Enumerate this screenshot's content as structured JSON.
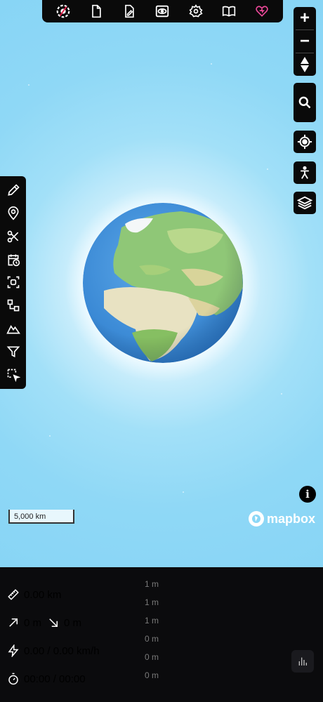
{
  "top_toolbar": {
    "items": [
      {
        "icon": "gpx-logo-icon"
      },
      {
        "icon": "new-file-icon"
      },
      {
        "icon": "edit-file-icon"
      },
      {
        "icon": "view-icon"
      },
      {
        "icon": "settings-gear-icon"
      },
      {
        "icon": "help-book-icon"
      },
      {
        "icon": "donate-heart-icon",
        "color": "#ec4899"
      }
    ]
  },
  "map_controls": {
    "zoom_in": "+",
    "zoom_out": "−",
    "compass": "compass-icon",
    "search": "search-icon",
    "locate": "locate-icon",
    "street_view": "pedestrian-icon",
    "layers": "layers-icon"
  },
  "left_tools": [
    {
      "icon": "pencil-icon"
    },
    {
      "icon": "map-pin-icon"
    },
    {
      "icon": "scissors-icon"
    },
    {
      "icon": "calendar-clock-icon"
    },
    {
      "icon": "scan-icon"
    },
    {
      "icon": "merge-icon"
    },
    {
      "icon": "mountain-icon"
    },
    {
      "icon": "filter-icon"
    },
    {
      "icon": "select-area-icon"
    }
  ],
  "map": {
    "scale_label": "5,000 km",
    "attribution_brand": "mapbox",
    "info_label": "i"
  },
  "stats": {
    "distance": "0.00 km",
    "elevation_up": "0 m",
    "elevation_down": "0 m",
    "speed": "0.00 / 0.00 km/h",
    "time": "00:00 / 00:00"
  },
  "elevation_axis": [
    "1 m",
    "1 m",
    "1 m",
    "0 m",
    "0 m",
    "0 m"
  ],
  "colors": {
    "toolbar_bg": "#0a0a0a",
    "sky": "#8ad7f6",
    "donate_accent": "#ec4899",
    "panel_bg": "#0b0b0d"
  }
}
